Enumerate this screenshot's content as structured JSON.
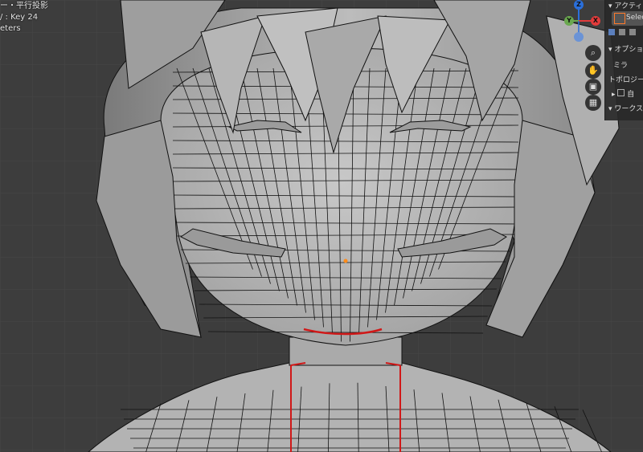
{
  "viewport": {
    "overlay": {
      "view_label": "ー・平行投影",
      "frame_label": "/ : Key 24",
      "units_label": "eters"
    }
  },
  "side_panel": {
    "active_tool_header": "アクティ",
    "active_tool_name": "Selec",
    "options_header": "オプショ",
    "mirror_label": "ミラ",
    "topology_label": "トポロジー",
    "auto_label": "自",
    "workspace_label": "ワークス"
  },
  "gizmo": {
    "x": "X",
    "y": "Y",
    "z": "Z"
  },
  "colors": {
    "background": "#3d3d3d",
    "mesh": "#b9b9b9",
    "wire": "#111111",
    "seam": "#d01818"
  }
}
